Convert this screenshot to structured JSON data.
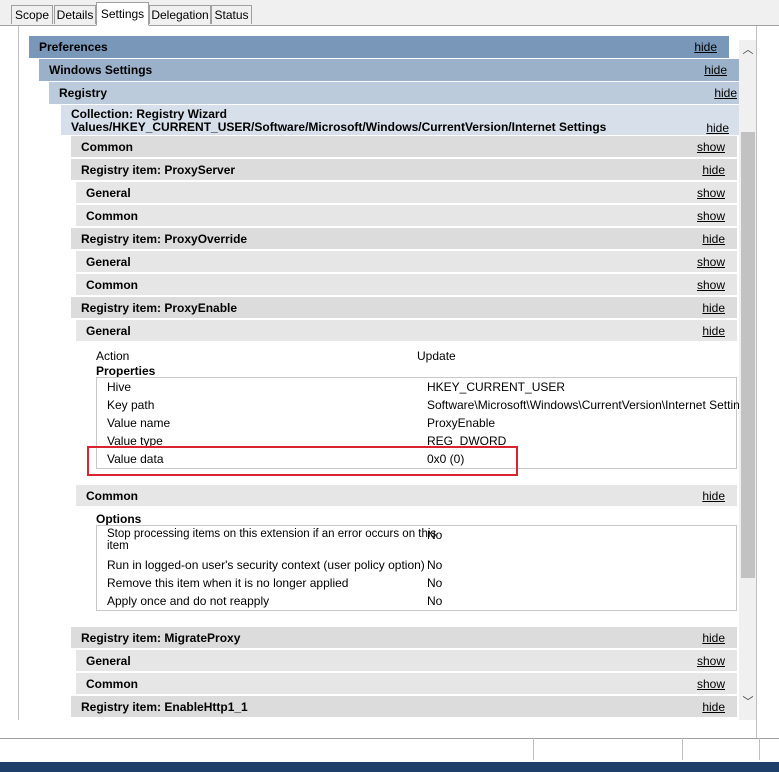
{
  "tabs": [
    "Scope",
    "Details",
    "Settings",
    "Delegation",
    "Status"
  ],
  "sections": {
    "preferences": {
      "title": "Preferences",
      "link": "hide"
    },
    "windows_settings": {
      "title": "Windows Settings",
      "link": "hide"
    },
    "registry": {
      "title": "Registry",
      "link": "hide"
    },
    "collection": {
      "title_line1": "Collection: Registry Wizard",
      "title_line2": "Values/HKEY_CURRENT_USER/Software/Microsoft/Windows/CurrentVersion/Internet Settings",
      "link": "hide"
    },
    "common_top": {
      "title": "Common",
      "link": "show"
    },
    "proxyserver": {
      "title": "Registry item: ProxyServer",
      "link": "hide"
    },
    "proxyserver_general": {
      "title": "General",
      "link": "show"
    },
    "proxyserver_common": {
      "title": "Common",
      "link": "show"
    },
    "proxyoverride": {
      "title": "Registry item: ProxyOverride",
      "link": "hide"
    },
    "proxyoverride_general": {
      "title": "General",
      "link": "show"
    },
    "proxyoverride_common": {
      "title": "Common",
      "link": "show"
    },
    "proxyenable": {
      "title": "Registry item: ProxyEnable",
      "link": "hide"
    },
    "proxyenable_general": {
      "title": "General",
      "link": "hide"
    },
    "proxyenable_common": {
      "title": "Common",
      "link": "hide"
    },
    "migrateproxy": {
      "title": "Registry item: MigrateProxy",
      "link": "hide"
    },
    "migrateproxy_general": {
      "title": "General",
      "link": "show"
    },
    "migrateproxy_common": {
      "title": "Common",
      "link": "show"
    },
    "enablehttp": {
      "title": "Registry item: EnableHttp1_1",
      "link": "hide"
    }
  },
  "general_details": {
    "action_label": "Action",
    "action_value": "Update",
    "properties_heading": "Properties",
    "rows": [
      {
        "label": "Hive",
        "value": "HKEY_CURRENT_USER"
      },
      {
        "label": "Key path",
        "value": "Software\\Microsoft\\Windows\\CurrentVersion\\Internet Settings"
      },
      {
        "label": "Value name",
        "value": "ProxyEnable"
      },
      {
        "label": "Value type",
        "value": "REG_DWORD"
      },
      {
        "label": "Value data",
        "value": "0x0 (0)"
      }
    ]
  },
  "common_details": {
    "options_heading": "Options",
    "rows": [
      {
        "label_line1": "Stop processing items on this extension if an error occurs on this",
        "label_line2": "item",
        "value": "No"
      },
      {
        "label_line1": "Run in logged-on user's security context (user policy option)",
        "label_line2": "",
        "value": "No"
      },
      {
        "label_line1": "Remove this item when it is no longer applied",
        "label_line2": "",
        "value": "No"
      },
      {
        "label_line1": "Apply once and do not reapply",
        "label_line2": "",
        "value": "No"
      }
    ]
  },
  "highlight_color": "#d9232e",
  "scroll_up_glyph": "︿",
  "scroll_down_glyph": "﹀"
}
